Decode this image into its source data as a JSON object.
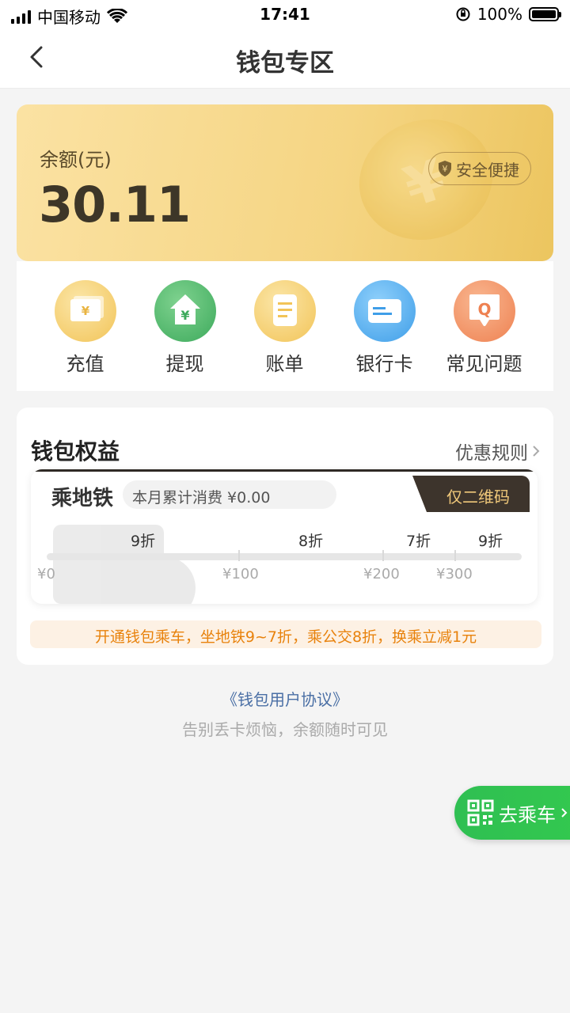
{
  "status_bar": {
    "carrier": "中国移动",
    "time": "17:41",
    "battery": "100%"
  },
  "nav": {
    "title": "钱包专区"
  },
  "balance": {
    "label": "余额(元)",
    "value": "30.11",
    "badge": "安全便捷"
  },
  "quick_actions": [
    {
      "label": "充值",
      "icon": "recharge-icon",
      "color": "#f5c860"
    },
    {
      "label": "提现",
      "icon": "withdraw-icon",
      "color": "#4db86b"
    },
    {
      "label": "账单",
      "icon": "bill-icon",
      "color": "#f5c860"
    },
    {
      "label": "银行卡",
      "icon": "bank-card-icon",
      "color": "#4aa8ef"
    },
    {
      "label": "常见问题",
      "icon": "faq-icon",
      "color": "#f0915a"
    }
  ],
  "benefits": {
    "title": "钱包权益",
    "rules_link": "优惠规则",
    "metro": {
      "name": "乘地铁",
      "spending": "本月累计消费 ¥0.00",
      "qr_only": "仅二维码",
      "discounts": [
        "9折",
        "8折",
        "7折",
        "9折"
      ],
      "thresholds": [
        "¥0",
        "¥100",
        "¥200",
        "¥300"
      ],
      "progress": 0
    },
    "promo": "开通钱包乘车，坐地铁9~7折，乘公交8折，换乘立减1元"
  },
  "footer": {
    "agreement": "《钱包用户协议》",
    "slogan": "告别丢卡烦恼，余额随时可见"
  },
  "ride_button": {
    "label": "去乘车"
  }
}
